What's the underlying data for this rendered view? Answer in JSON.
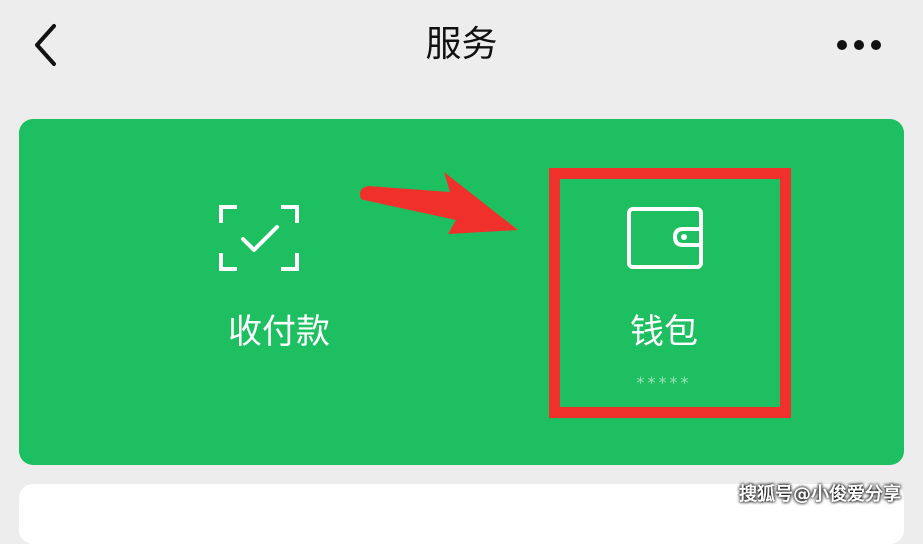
{
  "header": {
    "title": "服务",
    "back_icon": "chevron-left-icon",
    "more_icon": "more-dots-icon"
  },
  "services": {
    "pay": {
      "label": "收付款",
      "icon": "scan-check-icon"
    },
    "wallet": {
      "label": "钱包",
      "balance": "*****",
      "icon": "wallet-icon"
    }
  },
  "annotation": {
    "arrow_color": "#f0302a",
    "box_color": "#f0302a"
  },
  "colors": {
    "card_green": "#1dbf60",
    "background": "#ededed"
  },
  "watermark": "搜狐号@小俊爱分享"
}
